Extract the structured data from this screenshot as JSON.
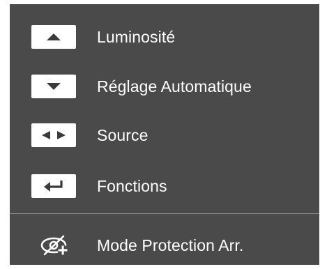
{
  "menu": {
    "items": [
      {
        "key_icon": "arrow-up-key-icon",
        "label": "Luminosité"
      },
      {
        "key_icon": "arrow-down-key-icon",
        "label": "Réglage Automatique"
      },
      {
        "key_icon": "left-right-key-icon",
        "label": "Source"
      },
      {
        "key_icon": "enter-key-icon",
        "label": "Fonctions"
      }
    ],
    "eye_saver": {
      "icon": "eye-saver-icon",
      "label": "Mode Protection Arr."
    }
  },
  "colors": {
    "panel_background": "#4a4a4a",
    "key_background": "#ffffff",
    "key_glyph": "#3a3a3a",
    "text": "#ffffff",
    "divider": "#8a8a8a"
  }
}
